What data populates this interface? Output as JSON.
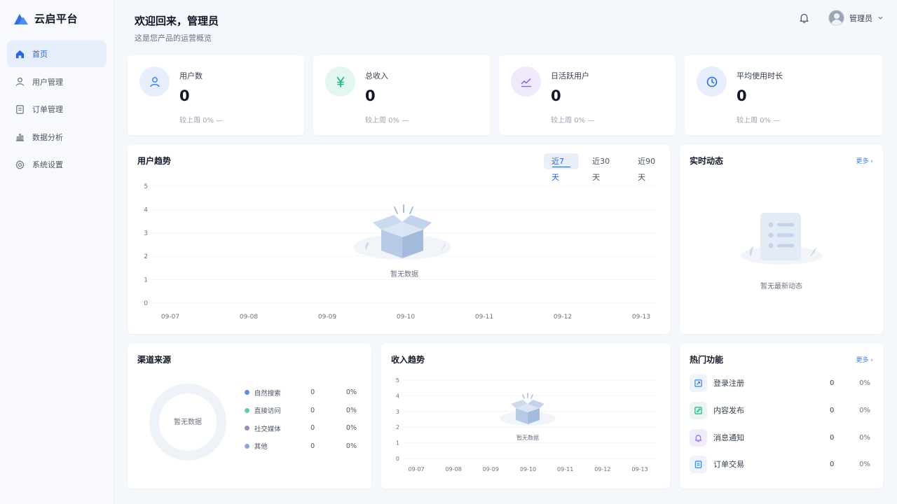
{
  "app": {
    "name": "云启平台"
  },
  "sidebar": {
    "items": [
      {
        "label": "首页",
        "icon": "home-icon",
        "active": true
      },
      {
        "label": "用户管理",
        "icon": "user-icon",
        "active": false
      },
      {
        "label": "订单管理",
        "icon": "document-icon",
        "active": false
      },
      {
        "label": "数据分析",
        "icon": "bar-chart-icon",
        "active": false
      },
      {
        "label": "系统设置",
        "icon": "gear-icon",
        "active": false
      }
    ]
  },
  "header": {
    "title": "欢迎回来，管理员",
    "subtitle": "这是您产品的运营概览",
    "user_name": "管理员"
  },
  "stats": [
    {
      "label": "用户数",
      "value": "0",
      "compare": "较上周 0%  —",
      "icon": "user-icon",
      "color": "#3b82f6"
    },
    {
      "label": "总收入",
      "value": "0",
      "compare": "较上周 0%  —",
      "icon": "yuan-icon",
      "color": "#10b981"
    },
    {
      "label": "日活跃用户",
      "value": "0",
      "compare": "较上周 0%  —",
      "icon": "trend-icon",
      "color": "#8b5cf6"
    },
    {
      "label": "平均使用时长",
      "value": "0",
      "compare": "较上周 0%  —",
      "icon": "clock-icon",
      "color": "#2563eb"
    }
  ],
  "user_trend": {
    "title": "用户趋势",
    "ranges": [
      "近7天",
      "近30天",
      "近90天"
    ],
    "active_range": "近7天",
    "empty_text": "暂无数据"
  },
  "activity": {
    "title": "实时动态",
    "more": "更多 ›",
    "empty_text": "暂无最新动态"
  },
  "channels": {
    "title": "渠道来源",
    "empty_text": "暂无数据",
    "items": [
      {
        "name": "自然搜索",
        "value": "0",
        "pct": "0%",
        "color": "#5b8def"
      },
      {
        "name": "直接访问",
        "value": "0",
        "pct": "0%",
        "color": "#5ccfb0"
      },
      {
        "name": "社交媒体",
        "value": "0",
        "pct": "0%",
        "color": "#a48ab8"
      },
      {
        "name": "其他",
        "value": "0",
        "pct": "0%",
        "color": "#8ea7db"
      }
    ]
  },
  "revenue_trend": {
    "title": "收入趋势",
    "empty_text": "暂无数据"
  },
  "hot_features": {
    "title": "热门功能",
    "more": "更多 ›",
    "items": [
      {
        "name": "登录注册",
        "value": "0",
        "pct": "0%",
        "icon": "login-icon"
      },
      {
        "name": "内容发布",
        "value": "0",
        "pct": "0%",
        "icon": "edit-icon"
      },
      {
        "name": "消息通知",
        "value": "0",
        "pct": "0%",
        "icon": "bell-icon"
      },
      {
        "name": "订单交易",
        "value": "0",
        "pct": "0%",
        "icon": "order-icon"
      }
    ]
  },
  "chart_data": [
    {
      "type": "line",
      "title": "用户趋势",
      "x": [
        "09-07",
        "09-08",
        "09-09",
        "09-10",
        "09-11",
        "09-12",
        "09-13"
      ],
      "series": [],
      "ylim": [
        0,
        5
      ],
      "yticks": [
        0,
        1,
        2,
        3,
        4,
        5
      ],
      "grid": true
    },
    {
      "type": "line",
      "title": "收入趋势",
      "x": [
        "09-07",
        "09-08",
        "09-09",
        "09-10",
        "09-11",
        "09-12",
        "09-13"
      ],
      "series": [],
      "ylim": [
        0,
        5
      ],
      "yticks": [
        0,
        1,
        2,
        3,
        4,
        5
      ],
      "grid": true
    },
    {
      "type": "pie",
      "title": "渠道来源",
      "categories": [
        "自然搜索",
        "直接访问",
        "社交媒体",
        "其他"
      ],
      "values": [
        0,
        0,
        0,
        0
      ]
    }
  ]
}
